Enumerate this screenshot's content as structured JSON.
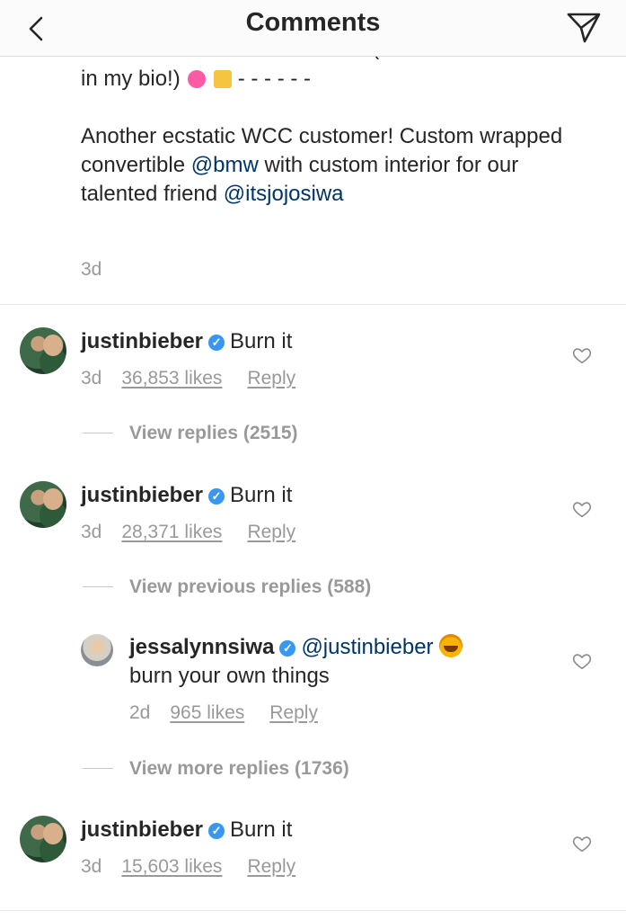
{
  "header": {
    "title": "Comments"
  },
  "caption": {
    "cut_line": "BEST CHRISTMAS EVER!! (link",
    "line_bio": "in my bio!)",
    "dashes": " - - - - - -",
    "text_part1": "Another ecstatic WCC customer! Custom wrapped convertible ",
    "mention_bmw": "@bmw",
    "text_part2": " with custom interior for our talented friend ",
    "mention_jojo": "@itsjojosiwa",
    "time": "3d"
  },
  "comments": [
    {
      "username": "justinbieber",
      "text": "Burn it",
      "time": "3d",
      "likes": "36,853 likes",
      "reply": "Reply"
    },
    {
      "username": "justinbieber",
      "text": "Burn it",
      "time": "3d",
      "likes": "28,371 likes",
      "reply": "Reply"
    },
    {
      "username": "justinbieber",
      "text": "Burn it",
      "time": "3d",
      "likes": "15,603 likes",
      "reply": "Reply"
    }
  ],
  "threads": {
    "view_replies": "View replies (2515)",
    "view_previous": "View previous replies (588)",
    "view_more": "View more replies (1736)"
  },
  "reply": {
    "username": "jessalynnsiwa",
    "mention": "@justinbieber",
    "text": "burn your own things",
    "time": "2d",
    "likes": "965 likes",
    "reply": "Reply"
  },
  "colors": {
    "link": "#003569",
    "verified": "#3897f0",
    "muted": "#999999"
  }
}
